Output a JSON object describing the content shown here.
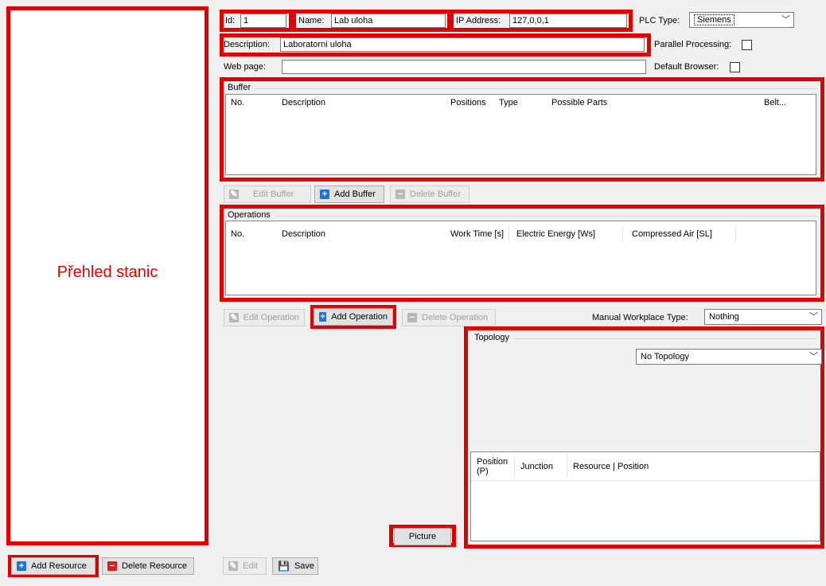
{
  "left_panel": {
    "caption": "Přehled stanic"
  },
  "bottom_left": {
    "add_resource": "Add Resource",
    "delete_resource": "Delete Resource"
  },
  "header": {
    "id_label": "Id:",
    "id_value": "1",
    "name_label": "Name:",
    "name_value": "Lab uloha",
    "ip_label": "IP Address:",
    "ip_value": "127,0,0,1",
    "plc_label": "PLC Type:",
    "plc_value": "Siemens",
    "description_label": "Description:",
    "description_value": "Laboratorni uloha",
    "parallel_label": "Parallel Processing:",
    "webpage_label": "Web page:",
    "webpage_value": "",
    "default_browser_label": "Default Browser:"
  },
  "buffer": {
    "title": "Buffer",
    "columns": [
      "No.",
      "Description",
      "Positions",
      "Type",
      "Possible Parts",
      "Belt..."
    ],
    "edit": "Edit Buffer",
    "add": "Add Buffer",
    "delete": "Delete Buffer"
  },
  "operations": {
    "title": "Operations",
    "columns": [
      "No.",
      "Description",
      "Work Time [s]",
      "Electric Energy [Ws]",
      "Compressed Air [SL]"
    ],
    "edit": "Edit Operation",
    "add": "Add Operation",
    "delete": "Delete Operation",
    "workplace_label": "Manual Workplace Type:",
    "workplace_value": "Nothing"
  },
  "topology": {
    "title": "Topology",
    "select_value": "No Topology",
    "columns": [
      "Position (P)",
      "Junction",
      "Resource | Position"
    ]
  },
  "footer": {
    "picture": "Picture",
    "edit": "Edit",
    "save": "Save"
  },
  "colors": {
    "highlight": "#e00000",
    "add_icon": "#1f73d4",
    "delete_icon": "#d42020"
  }
}
